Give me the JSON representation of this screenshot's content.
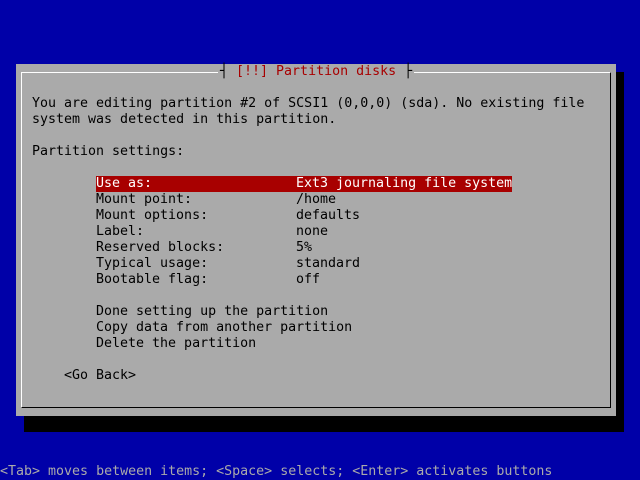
{
  "dialog": {
    "title_text": "[!!] Partition disks",
    "message_line1": "You are editing partition #2 of SCSI1 (0,0,0) (sda). No existing file",
    "message_line2": "system was detected in this partition.",
    "settings_heading": "Partition settings:",
    "settings": [
      {
        "label": "Use as:",
        "value": "Ext3 journaling file system",
        "selected": true
      },
      {
        "label": "Mount point:",
        "value": "/home",
        "selected": false
      },
      {
        "label": "Mount options:",
        "value": "defaults",
        "selected": false
      },
      {
        "label": "Label:",
        "value": "none",
        "selected": false
      },
      {
        "label": "Reserved blocks:",
        "value": "5%",
        "selected": false
      },
      {
        "label": "Typical usage:",
        "value": "standard",
        "selected": false
      },
      {
        "label": "Bootable flag:",
        "value": "off",
        "selected": false
      }
    ],
    "actions": [
      "Done setting up the partition",
      "Copy data from another partition",
      "Delete the partition"
    ],
    "go_back_label": "<Go Back>"
  },
  "status_bar": {
    "help_text": "<Tab> moves between items; <Space> selects; <Enter> activates buttons"
  },
  "colors": {
    "screen_background": "#0000a8",
    "dialog_background": "#aaaaaa",
    "highlight": "#a80000",
    "highlight_text": "#ffffff",
    "title_text": "#a80000",
    "status_text": "#aaaaaa"
  }
}
